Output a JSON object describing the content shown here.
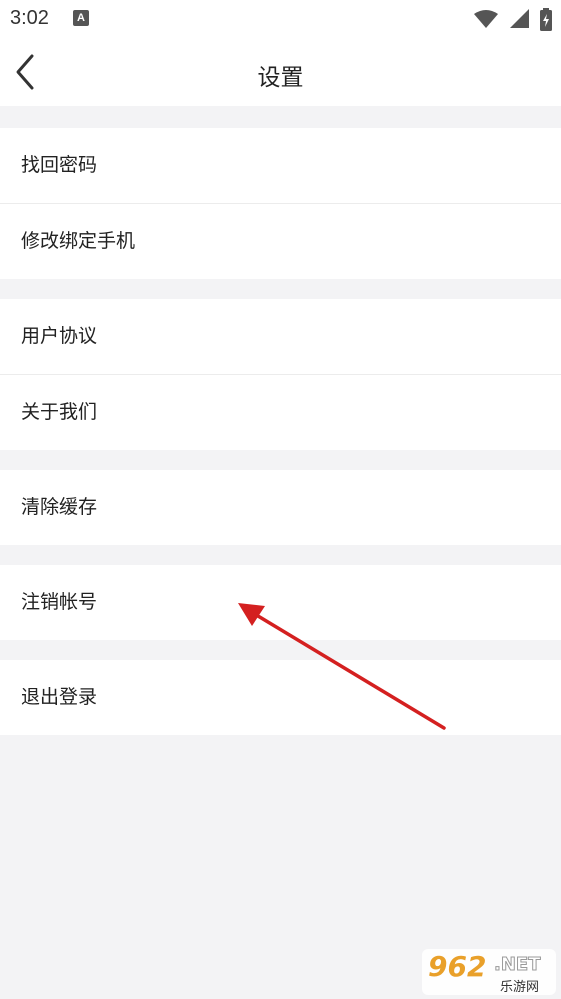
{
  "status_bar": {
    "time": "3:02",
    "notification_icon": "A",
    "icons": [
      "wifi-icon",
      "cellular-signal-icon",
      "battery-icon"
    ]
  },
  "nav": {
    "back_icon": "chevron-left-icon",
    "title": "设置"
  },
  "groups": [
    {
      "items": [
        {
          "label": "找回密码"
        },
        {
          "label": "修改绑定手机"
        }
      ]
    },
    {
      "items": [
        {
          "label": "用户协议"
        },
        {
          "label": "关于我们"
        }
      ]
    },
    {
      "items": [
        {
          "label": "清除缓存"
        }
      ]
    },
    {
      "items": [
        {
          "label": "注销帐号"
        }
      ]
    },
    {
      "items": [
        {
          "label": "退出登录"
        }
      ]
    }
  ],
  "annotation": {
    "color": "#d42020"
  },
  "watermark": {
    "logo": "962",
    "suffix": ".NET",
    "subtitle": "乐游网"
  },
  "colors": {
    "background": "#f3f3f5",
    "surface": "#ffffff",
    "divider": "#ececec",
    "text": "#222222"
  }
}
